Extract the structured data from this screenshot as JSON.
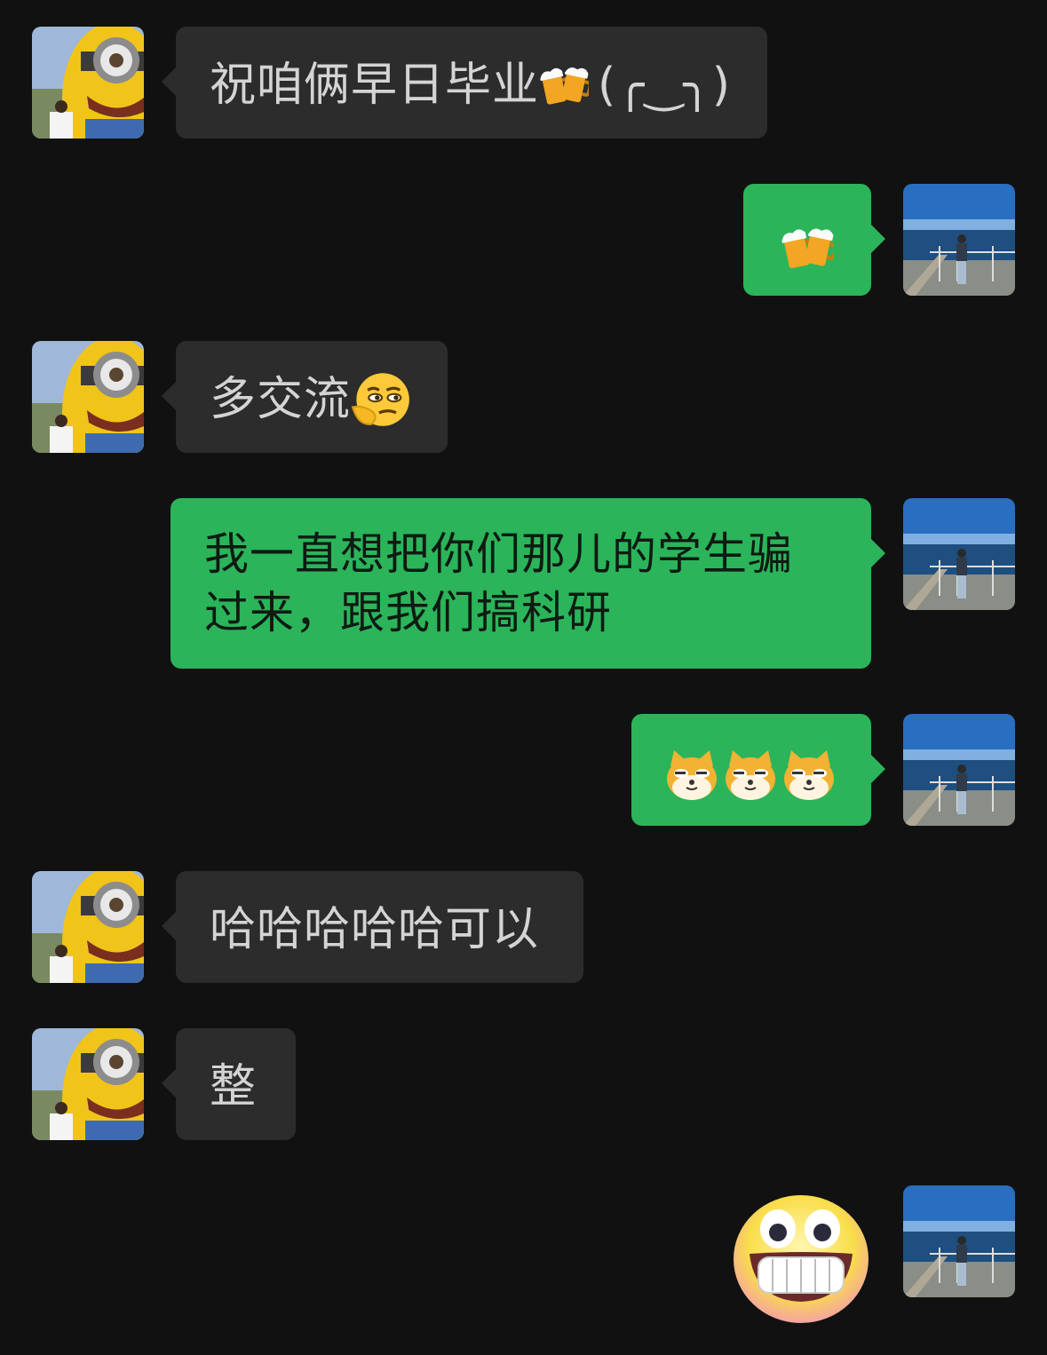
{
  "chat": {
    "messages": [
      {
        "side": "in",
        "text": "祝咱俩早日毕业",
        "emoji": "beer-mugs-emoji",
        "suffix": "(╭‿╮)"
      },
      {
        "side": "out",
        "text": "",
        "emoji": "beer-mugs-emoji"
      },
      {
        "side": "in",
        "text": "多交流",
        "emoji": "thinking-smirk-emoji"
      },
      {
        "side": "out",
        "text": "我一直想把你们那儿的学生骗过来，跟我们搞科研"
      },
      {
        "side": "out",
        "text": "",
        "emoji": "doge-emoji ×3"
      },
      {
        "side": "in",
        "text": "哈哈哈哈哈可以"
      },
      {
        "side": "in",
        "text": "整"
      },
      {
        "side": "out",
        "text": "",
        "emoji": "big-grin-sticker"
      }
    ]
  },
  "colors": {
    "background": "#111111",
    "incoming_bubble": "#2c2c2c",
    "outgoing_bubble": "#2bb45a",
    "incoming_text": "#d4d4d4"
  }
}
